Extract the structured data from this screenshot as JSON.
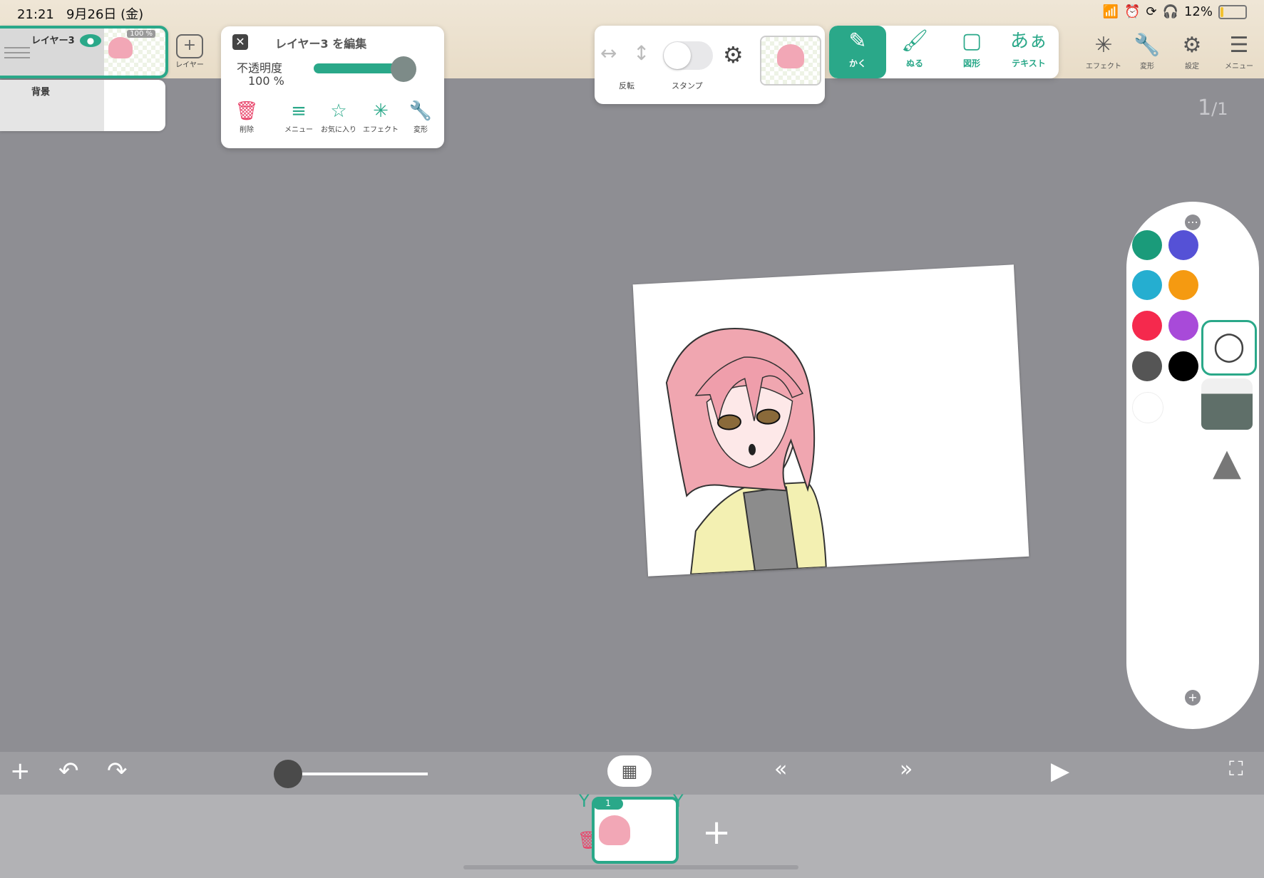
{
  "status": {
    "time": "21:21",
    "date": "9月26日 (金)",
    "battery": "12%",
    "battery_level": 0.12
  },
  "layers": {
    "layer3": {
      "name": "レイヤー3",
      "opacity": "100 %"
    },
    "background": {
      "name": "背景"
    },
    "add_label": "レイヤー"
  },
  "edit_panel": {
    "title": "レイヤー3 を編集",
    "opacity_label": "不透明度",
    "opacity_value": "100 %",
    "opacity_fraction": 1.0,
    "buttons": {
      "delete": "削除",
      "menu": "メニュー",
      "favorite": "お気に入り",
      "effect": "エフェクト",
      "transform": "変形"
    }
  },
  "flip_panel": {
    "flip_label": "反転",
    "stamp_label": "スタンプ"
  },
  "tools": {
    "draw": "かく",
    "fill": "ぬる",
    "shape": "図形",
    "text_icon": "あぁ",
    "text": "テキスト"
  },
  "top_icons": {
    "effect": "エフェクト",
    "transform": "変形",
    "settings": "設定",
    "menu": "メニュー"
  },
  "page_counter": {
    "current": "1",
    "total": "1"
  },
  "palette": {
    "colors": [
      "#1a9b7a",
      "#5551d6",
      "#25aed0",
      "#f59a11",
      "#f5294d",
      "#a84ad9",
      "#555555",
      "#000000",
      "#ffffff"
    ]
  },
  "timeline": {
    "frame_number": "1"
  },
  "theme": {
    "accent": "#2aa889"
  }
}
